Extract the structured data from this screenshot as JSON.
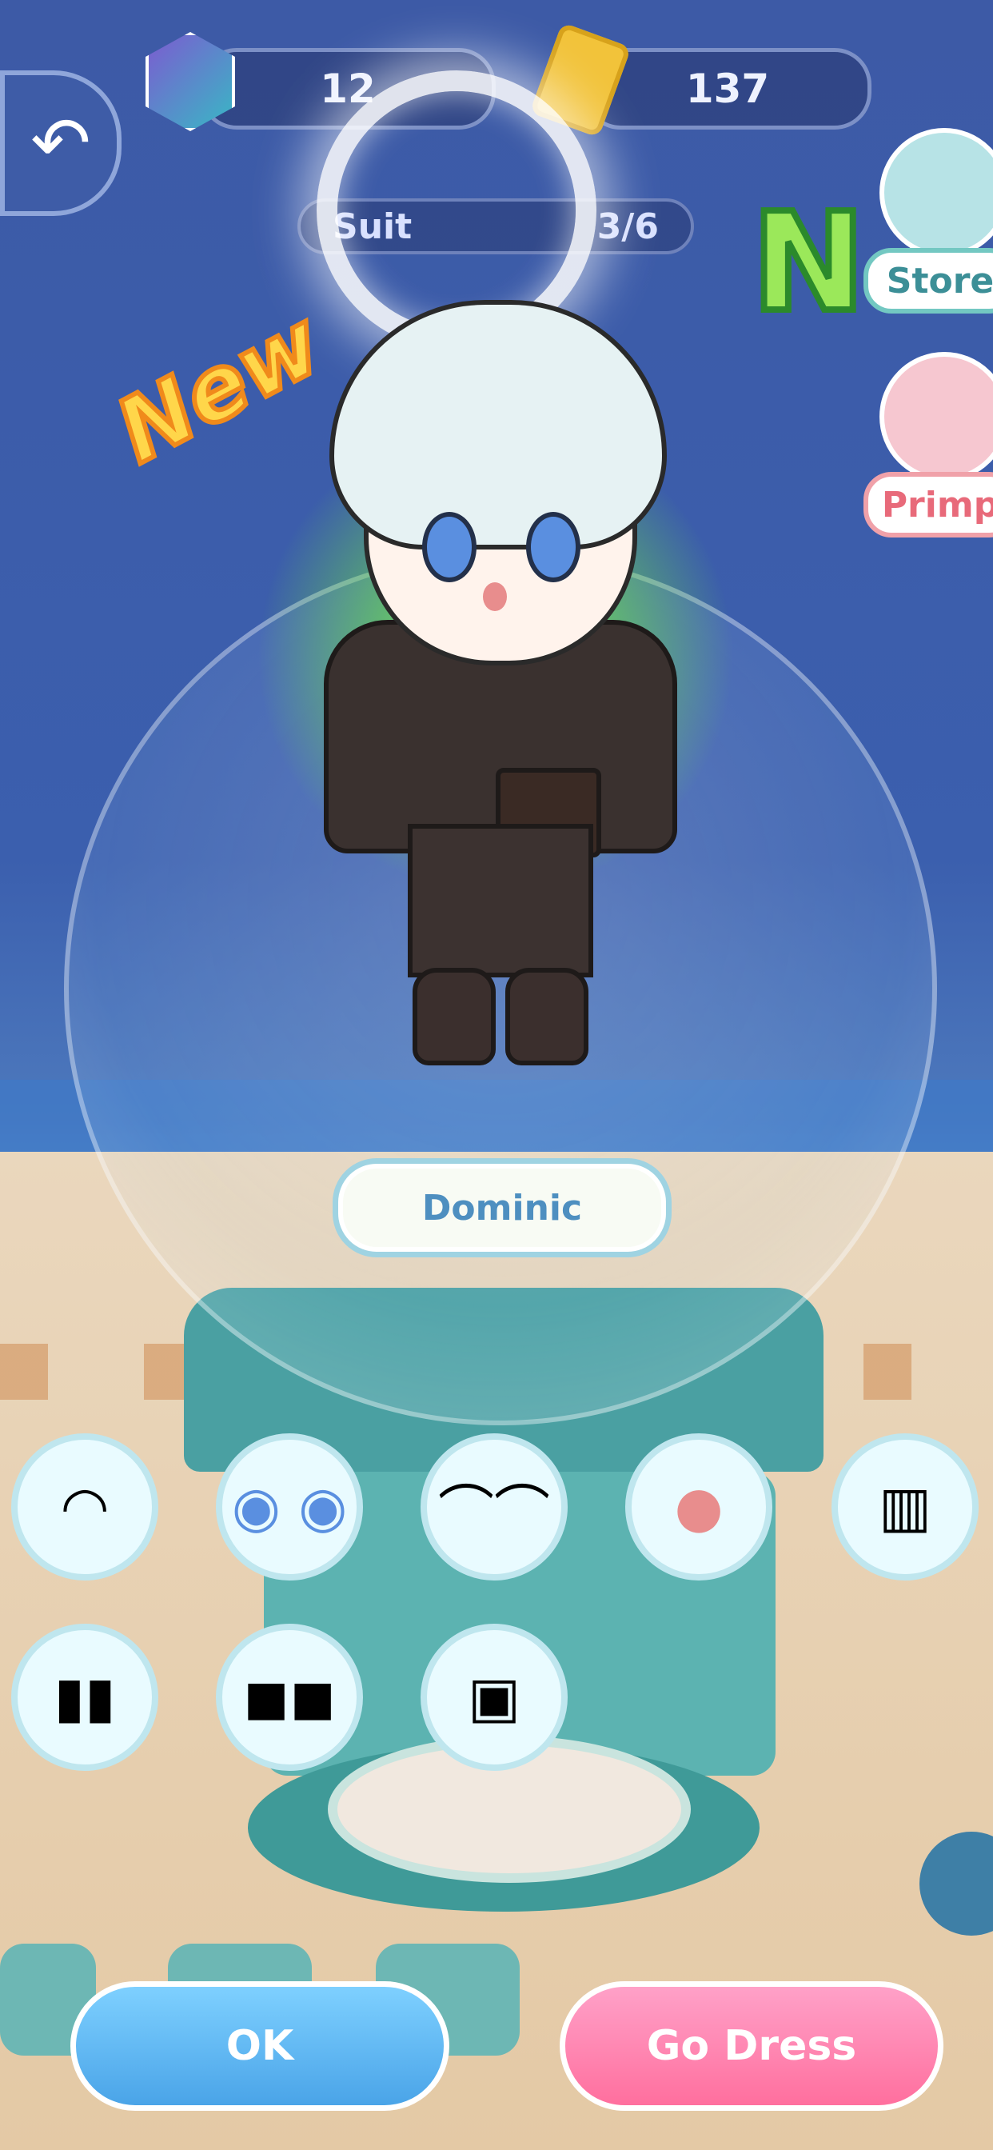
{
  "topbar": {
    "gems": "12",
    "tickets": "137",
    "suit_label": "Suit",
    "suit_progress": "3/6"
  },
  "side": {
    "store_label": "Store",
    "primp_label": "Primp"
  },
  "badges": {
    "rarity": "N",
    "new": "New"
  },
  "character": {
    "name": "Dominic"
  },
  "parts": [
    {
      "name": "hair",
      "icon": "hair-icon"
    },
    {
      "name": "eyes",
      "icon": "eyes-icon"
    },
    {
      "name": "brows",
      "icon": "brows-icon"
    },
    {
      "name": "mouth",
      "icon": "mouth-icon"
    },
    {
      "name": "jacket",
      "icon": "jacket-icon"
    },
    {
      "name": "pants",
      "icon": "pants-icon"
    },
    {
      "name": "shoes",
      "icon": "shoes-icon"
    },
    {
      "name": "bag",
      "icon": "bag-icon"
    }
  ],
  "buttons": {
    "ok": "OK",
    "go_dress": "Go Dress"
  },
  "colors": {
    "sky": "#3b5fae",
    "accent_blue": "#4aa4e8",
    "accent_pink": "#ff6f9e",
    "glow": "#8ef05a"
  }
}
